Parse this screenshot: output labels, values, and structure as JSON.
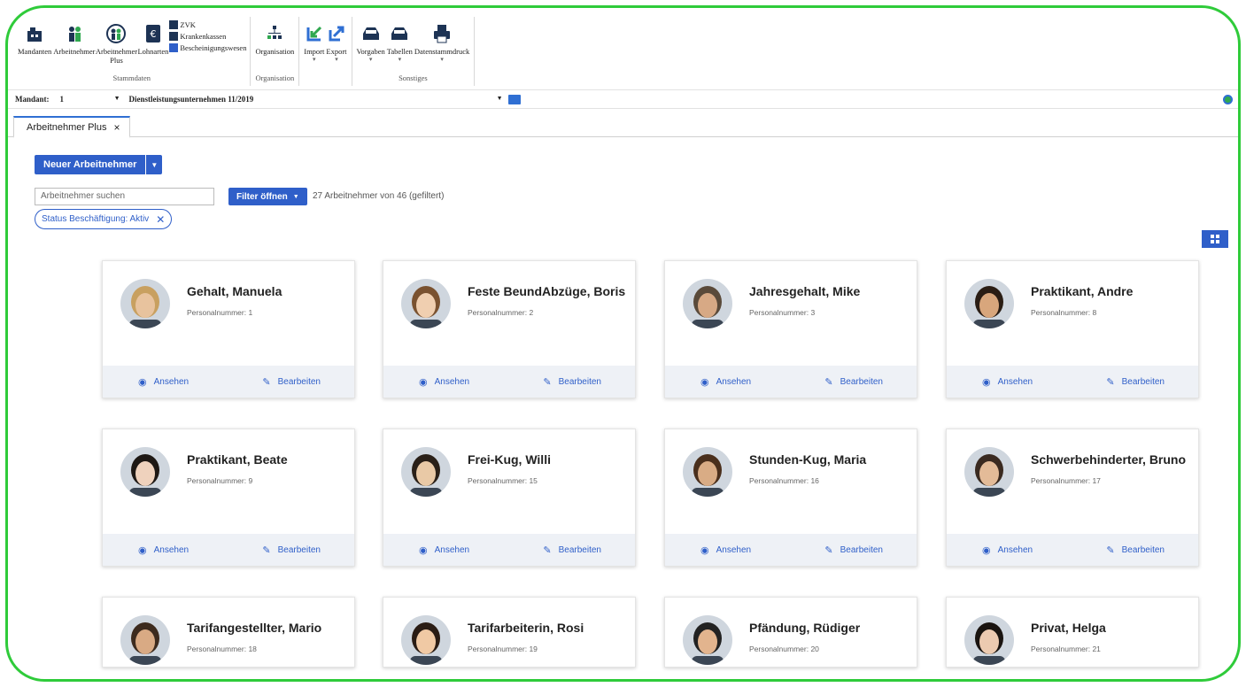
{
  "ribbon": {
    "stammdaten": {
      "buttons": [
        {
          "label": "Mandanten",
          "icon": "building-icon"
        },
        {
          "label": "Arbeitnehmer",
          "icon": "employees-icon"
        },
        {
          "label": "Arbeitnehmer Plus",
          "icon": "employee-plus-icon"
        },
        {
          "label": "Lohnarten",
          "icon": "wage-types-icon"
        }
      ],
      "small": [
        "ZVK",
        "Krankenkassen",
        "Bescheinigungswesen"
      ],
      "label": "Stammdaten"
    },
    "organisation": {
      "buttons": [
        {
          "label": "Organisation",
          "icon": "org-chart-icon"
        }
      ],
      "label": "Organisation"
    },
    "io": {
      "buttons": [
        {
          "label": "Import",
          "icon": "import-icon"
        },
        {
          "label": "Export",
          "icon": "export-icon"
        }
      ]
    },
    "sonstiges": {
      "buttons": [
        {
          "label": "Vorgaben",
          "icon": "tray-icon"
        },
        {
          "label": "Tabellen",
          "icon": "tray-icon"
        },
        {
          "label": "Datenstammdruck",
          "icon": "printer-icon"
        }
      ],
      "label": "Sonstiges"
    }
  },
  "mandant": {
    "label": "Mandant:",
    "number": "1",
    "name": "Dienstleistungsunternehmen 11/2019"
  },
  "tab": {
    "label": "Arbeitnehmer Plus",
    "close": "×"
  },
  "actions": {
    "new_employee": "Neuer Arbeitnehmer",
    "filter": "Filter öffnen",
    "filter_count": "27 Arbeitnehmer von 46 (gefiltert)"
  },
  "search": {
    "placeholder": "Arbeitnehmer suchen"
  },
  "chip": {
    "label": "Status Beschäftigung: Aktiv",
    "close": "✕"
  },
  "card_actions": {
    "view": "Ansehen",
    "edit": "Bearbeiten"
  },
  "employees": [
    {
      "name": "Gehalt, Manuela",
      "pnr": "Personalnummer: 1",
      "skin": "#e8c39e",
      "hair": "#c8a060"
    },
    {
      "name": "Feste BeundAbzüge, Boris",
      "pnr": "Personalnummer: 2",
      "skin": "#f0cfb0",
      "hair": "#7a5230"
    },
    {
      "name": "Jahresgehalt, Mike",
      "pnr": "Personalnummer: 3",
      "skin": "#d7a985",
      "hair": "#5a4a3a"
    },
    {
      "name": "Praktikant, Andre",
      "pnr": "Personalnummer: 8",
      "skin": "#d8a67c",
      "hair": "#2a1d14"
    },
    {
      "name": "Praktikant, Beate",
      "pnr": "Personalnummer: 9",
      "skin": "#efd2bd",
      "hair": "#1e1814"
    },
    {
      "name": "Frei-Kug, Willi",
      "pnr": "Personalnummer: 15",
      "skin": "#e9c9a6",
      "hair": "#2a2018"
    },
    {
      "name": "Stunden-Kug, Maria",
      "pnr": "Personalnummer: 16",
      "skin": "#d9ac85",
      "hair": "#4a2f1c"
    },
    {
      "name": "Schwerbehinderter, Bruno",
      "pnr": "Personalnummer: 17",
      "skin": "#e3bb98",
      "hair": "#3a2a20"
    },
    {
      "name": "Tarifangestellter, Mario",
      "pnr": "Personalnummer: 18",
      "skin": "#d9aa84",
      "hair": "#3d2b1e"
    },
    {
      "name": "Tarifarbeiterin, Rosi",
      "pnr": "Personalnummer: 19",
      "skin": "#f0c9a4",
      "hair": "#2a1c14"
    },
    {
      "name": "Pfändung, Rüdiger",
      "pnr": "Personalnummer: 20",
      "skin": "#e2b48e",
      "hair": "#222222"
    },
    {
      "name": "Privat, Helga",
      "pnr": "Personalnummer: 21",
      "skin": "#eccab0",
      "hair": "#1a1410"
    }
  ],
  "colors": {
    "accent": "#2f5fc9",
    "frame": "#2fcb3a"
  }
}
